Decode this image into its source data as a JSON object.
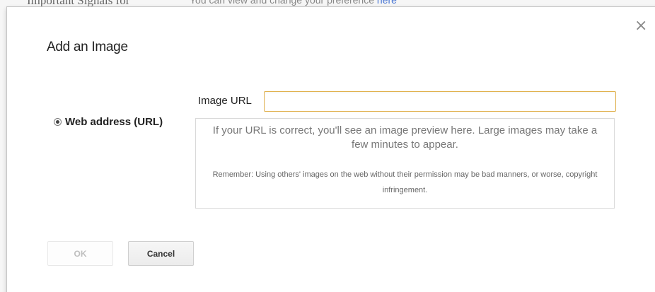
{
  "background": {
    "left_text": "Important Signals for",
    "right_text": "You can view and change your preference",
    "right_link": "here"
  },
  "dialog": {
    "title": "Add an Image",
    "close_icon": "close-icon",
    "close_glyph": "×",
    "source_option": {
      "label": "Web address (URL)",
      "selected": true
    },
    "url_field": {
      "label": "Image URL",
      "value": "",
      "placeholder": ""
    },
    "preview": {
      "main_text": "If your URL is correct, you'll see an image preview here. Large images may take a few minutes to appear.",
      "note_text": "Remember: Using others' images on the web without their permission may be bad manners, or worse, copyright infringement."
    },
    "buttons": {
      "ok_label": "OK",
      "ok_disabled": true,
      "cancel_label": "Cancel"
    },
    "colors": {
      "focus_border": "#e0b04c",
      "link": "#4a77d4",
      "disabled_text": "#bfbfbf"
    }
  }
}
